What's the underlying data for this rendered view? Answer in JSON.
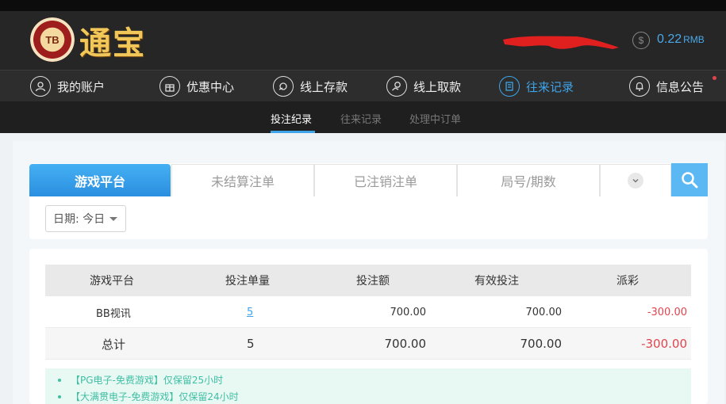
{
  "header": {
    "logo_badge": "TB",
    "logo_text": "通宝",
    "balance_icon": "$",
    "balance_value": "0.22",
    "balance_unit": "RMB"
  },
  "nav": [
    {
      "label": "我的账户",
      "icon": "user-icon"
    },
    {
      "label": "优惠中心",
      "icon": "gift-icon"
    },
    {
      "label": "线上存款",
      "icon": "deposit-icon"
    },
    {
      "label": "线上取款",
      "icon": "withdraw-icon"
    },
    {
      "label": "往来记录",
      "icon": "record-icon"
    },
    {
      "label": "信息公告",
      "icon": "bell-icon"
    }
  ],
  "subnav": [
    "投注纪录",
    "往来记录",
    "处理中订单"
  ],
  "tabs": [
    "游戏平台",
    "未结算注单",
    "已注销注单",
    "局号/期数"
  ],
  "date_filter": "日期: 今日",
  "table": {
    "headers": [
      "游戏平台",
      "投注单量",
      "投注额",
      "有效投注",
      "派彩"
    ],
    "rows": [
      [
        "BB视讯",
        "5",
        "700.00",
        "700.00",
        "-300.00"
      ],
      [
        "总计",
        "5",
        "700.00",
        "700.00",
        "-300.00"
      ]
    ]
  },
  "notes": [
    "【PG电子-免费游戏】仅保留25小时",
    "【大满贯电子-免费游戏】仅保留24小时"
  ],
  "colors": {
    "accent": "#3ea3e8",
    "negative": "#e0454f",
    "gold": "#f1c75a",
    "note": "#3fbfa3"
  }
}
